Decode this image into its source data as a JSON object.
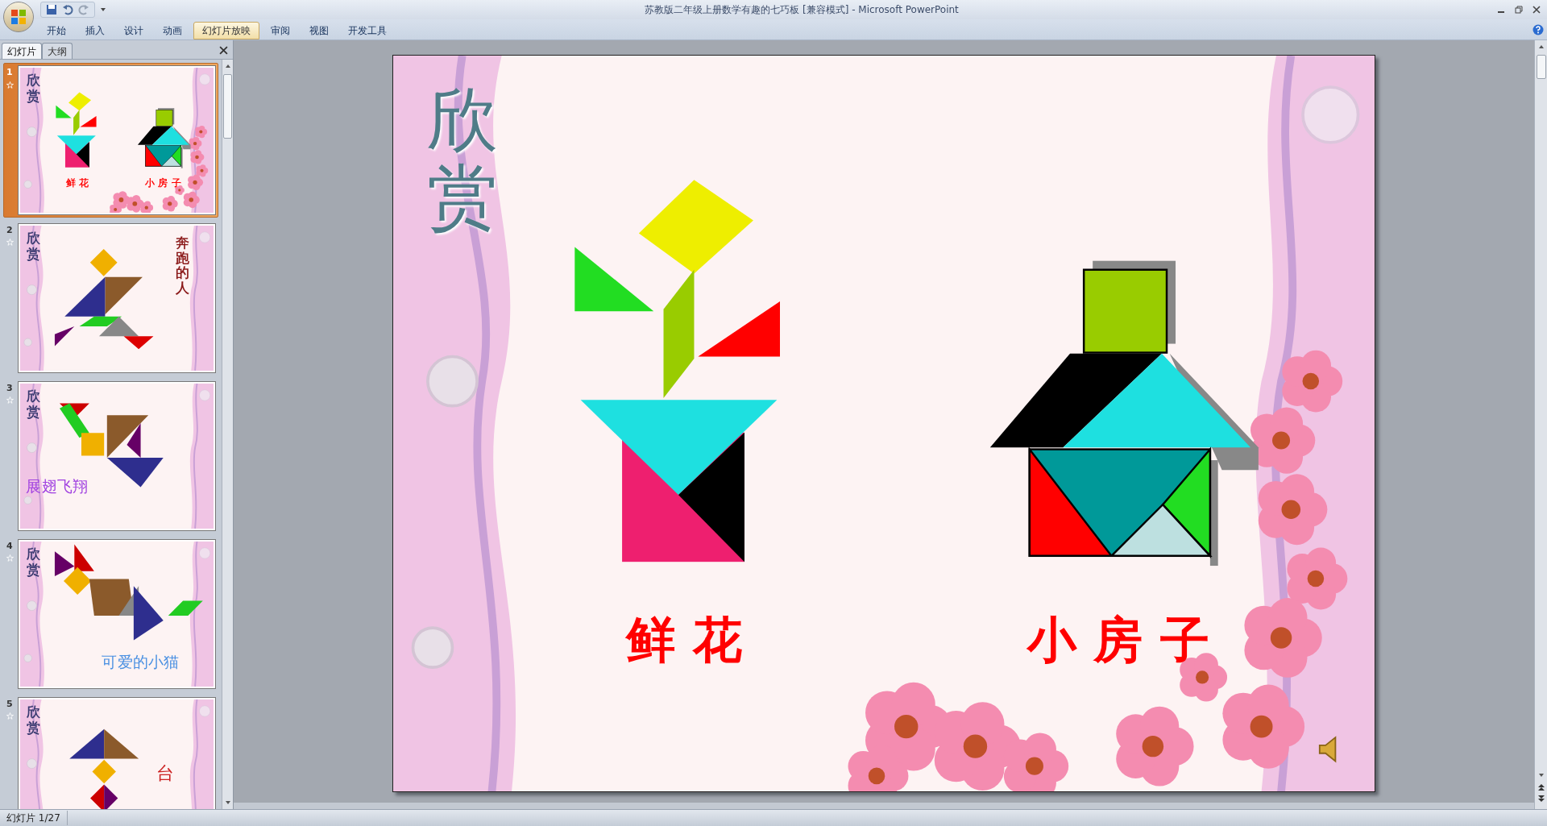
{
  "window": {
    "title": "苏教版二年级上册数学有趣的七巧板 [兼容模式] - Microsoft PowerPoint"
  },
  "ribbon_tabs": [
    {
      "label": "开始",
      "selected": false
    },
    {
      "label": "插入",
      "selected": false
    },
    {
      "label": "设计",
      "selected": false
    },
    {
      "label": "动画",
      "selected": false
    },
    {
      "label": "幻灯片放映",
      "selected": true
    },
    {
      "label": "审阅",
      "selected": false
    },
    {
      "label": "视图",
      "selected": false
    },
    {
      "label": "开发工具",
      "selected": false
    }
  ],
  "panel_tabs": [
    {
      "label": "幻灯片",
      "selected": true
    },
    {
      "label": "大纲",
      "selected": false
    }
  ],
  "slides": [
    {
      "number": "1",
      "selected": true,
      "title": "欣赏",
      "kind": "flower_house",
      "captions": [
        "鲜 花",
        "小 房 子"
      ]
    },
    {
      "number": "2",
      "selected": false,
      "title": "欣赏",
      "kind": "running_person",
      "captions": [
        "奔跑的人"
      ]
    },
    {
      "number": "3",
      "selected": false,
      "title": "欣赏",
      "kind": "bird",
      "captions": [
        "展翅飞翔"
      ]
    },
    {
      "number": "4",
      "selected": false,
      "title": "欣赏",
      "kind": "cat",
      "captions": [
        "可爱的小猫"
      ]
    },
    {
      "number": "5",
      "selected": false,
      "title": "欣赏",
      "kind": "lamp",
      "captions": [
        "台"
      ]
    }
  ],
  "current_slide": {
    "title": "欣赏",
    "kind": "flower_house",
    "captions": [
      "鲜 花",
      "小 房 子"
    ]
  },
  "status_bar": {
    "slide_counter": "幻灯片 1/27"
  }
}
